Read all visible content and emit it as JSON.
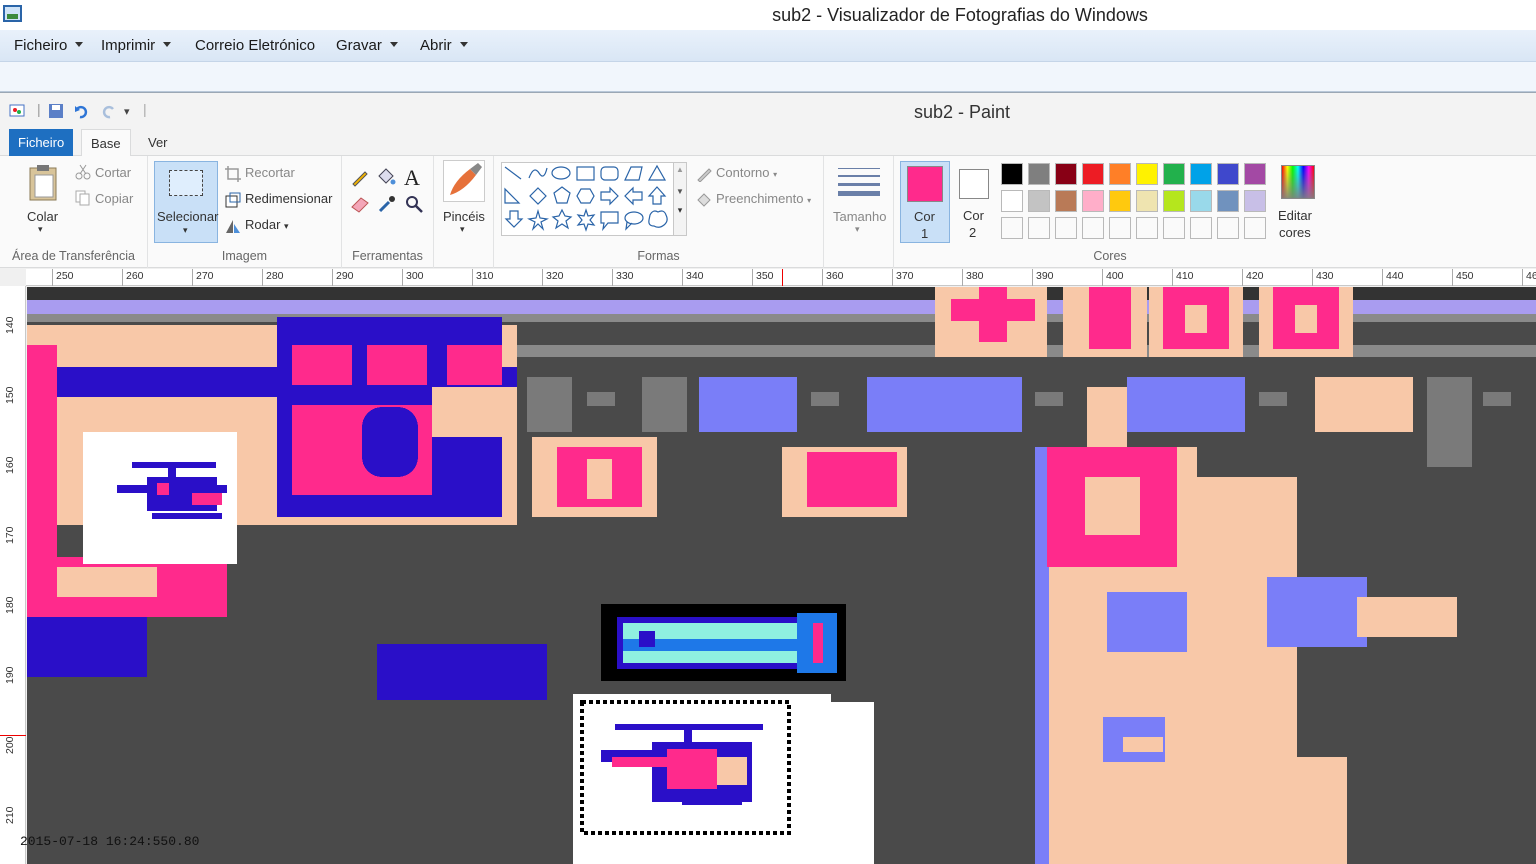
{
  "photo_viewer": {
    "title": "sub2 - Visualizador de Fotografias do Windows",
    "menu": [
      "Ficheiro",
      "Imprimir",
      "Correio Eletrónico",
      "Gravar",
      "Abrir"
    ]
  },
  "paint": {
    "title": "sub2 - Paint",
    "tabs": {
      "file": "Ficheiro",
      "home": "Base",
      "view": "Ver"
    },
    "clipboard": {
      "paste": "Colar",
      "cut": "Cortar",
      "copy": "Copiar",
      "label": "Área de Transferência"
    },
    "image": {
      "select": "Selecionar",
      "crop": "Recortar",
      "resize": "Redimensionar",
      "rotate": "Rodar",
      "label": "Imagem"
    },
    "tools": {
      "label": "Ferramentas"
    },
    "brushes": {
      "label": "Pincéis"
    },
    "shapes": {
      "outline": "Contorno",
      "fill": "Preenchimento",
      "label": "Formas"
    },
    "size": {
      "label": "Tamanho"
    },
    "colors": {
      "color1_label": "Cor",
      "color1_num": "1",
      "color2_label": "Cor",
      "color2_num": "2",
      "edit_label": "Editar",
      "edit_label2": "cores",
      "label": "Cores",
      "color1": "#ff2a8c",
      "color2": "#ffffff",
      "palette_row1": [
        "#000000",
        "#7f7f7f",
        "#880015",
        "#ed1c24",
        "#ff7f27",
        "#fff200",
        "#22b14c",
        "#00a2e8",
        "#3f48cc",
        "#a349a4"
      ],
      "palette_row2": [
        "#ffffff",
        "#c3c3c3",
        "#b97a57",
        "#ffaec9",
        "#ffc90e",
        "#efe4b0",
        "#b5e61d",
        "#99d9ea",
        "#7092be",
        "#c8bfe7"
      ]
    },
    "ruler_h": [
      "250",
      "260",
      "270",
      "280",
      "290",
      "300",
      "310",
      "320",
      "330",
      "340",
      "350",
      "360",
      "370",
      "380",
      "390",
      "400",
      "410",
      "420",
      "430",
      "440",
      "450",
      "46"
    ],
    "ruler_v": [
      "140",
      "150",
      "160",
      "170",
      "180",
      "190",
      "200",
      "210"
    ]
  },
  "timestamp": "2015-07-18 16:24:550.80"
}
